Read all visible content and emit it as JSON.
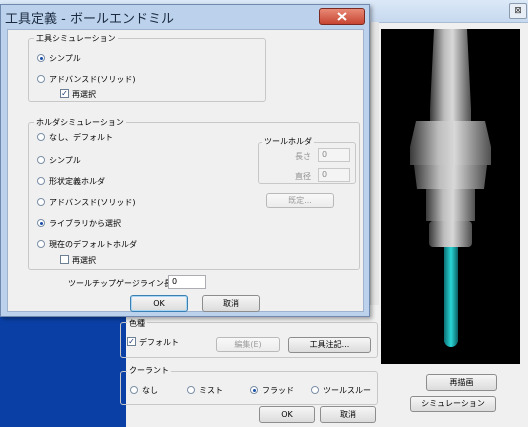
{
  "dialog": {
    "title": "工具定義 - ボールエンドミル",
    "tool_sim": {
      "title": "工具シミュレーション",
      "simple": "シンプル",
      "advanced": "アドバンスド(ソリッド)",
      "reselect": "再選択"
    },
    "holder_sim": {
      "title": "ホルダシミュレーション",
      "none_default": "なし、デフォルト",
      "simple": "シンプル",
      "shape_def": "形状定義ホルダ",
      "advanced": "アドバンスド(ソリッド)",
      "from_library": "ライブラリから選択",
      "current_default": "現在のデフォルトホルダ",
      "reselect": "再選択"
    },
    "tool_holder": {
      "title": "ツールホルダ",
      "length_label": "長さ",
      "length_value": "0",
      "diameter_label": "直径",
      "diameter_value": "0",
      "settings_button": "既定..."
    },
    "gauge_line_label": "ツールチップゲージライン長",
    "gauge_line_value": "0",
    "ok": "OK",
    "cancel": "取消"
  },
  "background": {
    "close_glyph": "⊠",
    "color_group": {
      "title": "色種",
      "default": "デフォルト",
      "edit_button": "編集(E)",
      "tool_note_button": "工具注記..."
    },
    "coolant": {
      "title": "クーラント",
      "none": "なし",
      "mist": "ミスト",
      "flood": "フラッド",
      "through": "ツールスルー"
    },
    "redraw_button": "再描画",
    "simulation_button": "シミュレーション",
    "ok": "OK",
    "cancel": "取消"
  },
  "colors": {
    "tool_tip": "#20c8c8",
    "holder": "#9a9a9a",
    "preview_bg": "#000000",
    "blue_panel": "#0a40a6"
  }
}
